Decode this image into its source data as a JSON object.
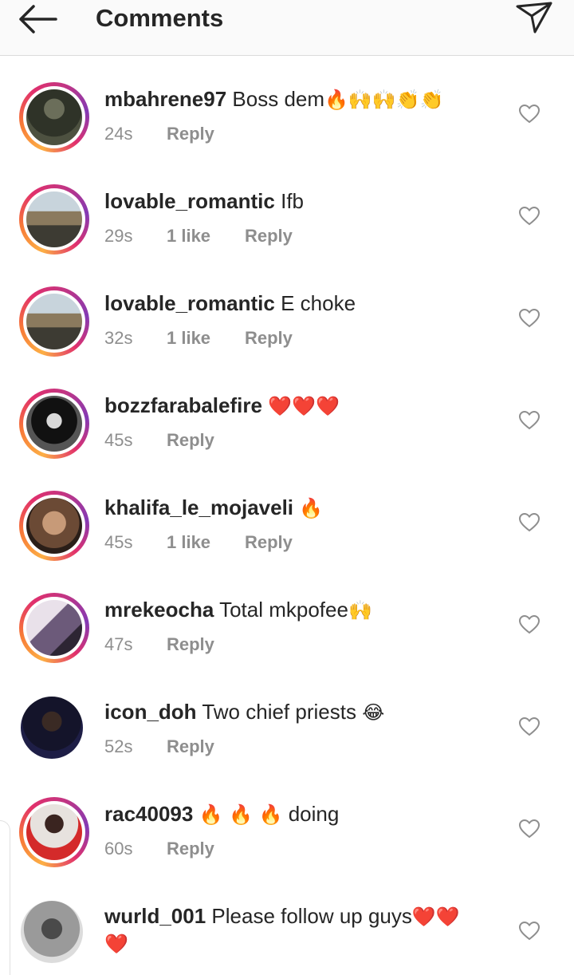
{
  "header": {
    "title": "Comments"
  },
  "comments": [
    {
      "username": "mbahrene97",
      "text": "Boss dem",
      "emoji": "🔥🙌🙌👏👏",
      "time": "24s",
      "likes": "",
      "reply": "Reply",
      "ring": true
    },
    {
      "username": "lovable_romantic",
      "text": "Ifb",
      "emoji": "",
      "time": "29s",
      "likes": "1 like",
      "reply": "Reply",
      "ring": true
    },
    {
      "username": "lovable_romantic",
      "text": "E choke",
      "emoji": "",
      "time": "32s",
      "likes": "1 like",
      "reply": "Reply",
      "ring": true
    },
    {
      "username": "bozzfarabalefire",
      "text": "",
      "emoji": "❤️❤️❤️",
      "time": "45s",
      "likes": "",
      "reply": "Reply",
      "ring": true
    },
    {
      "username": "khalifa_le_mojaveli",
      "text": "",
      "emoji": "🔥",
      "time": "45s",
      "likes": "1 like",
      "reply": "Reply",
      "ring": true
    },
    {
      "username": "mrekeocha",
      "text": "Total mkpofee",
      "emoji": "🙌",
      "time": "47s",
      "likes": "",
      "reply": "Reply",
      "ring": true
    },
    {
      "username": "icon_doh",
      "text": "Two chief priests",
      "emoji": "😂",
      "time": "52s",
      "likes": "",
      "reply": "Reply",
      "ring": false
    },
    {
      "username": "rac40093",
      "text": "doing",
      "emoji": "🔥 🔥 🔥",
      "time": "60s",
      "likes": "",
      "reply": "Reply",
      "ring": true
    },
    {
      "username": "wurld_001",
      "text": "Please follow up guys",
      "emoji": "❤️❤️",
      "emoji2": "❤️",
      "time": "",
      "likes": "",
      "reply": "",
      "ring": false
    }
  ]
}
